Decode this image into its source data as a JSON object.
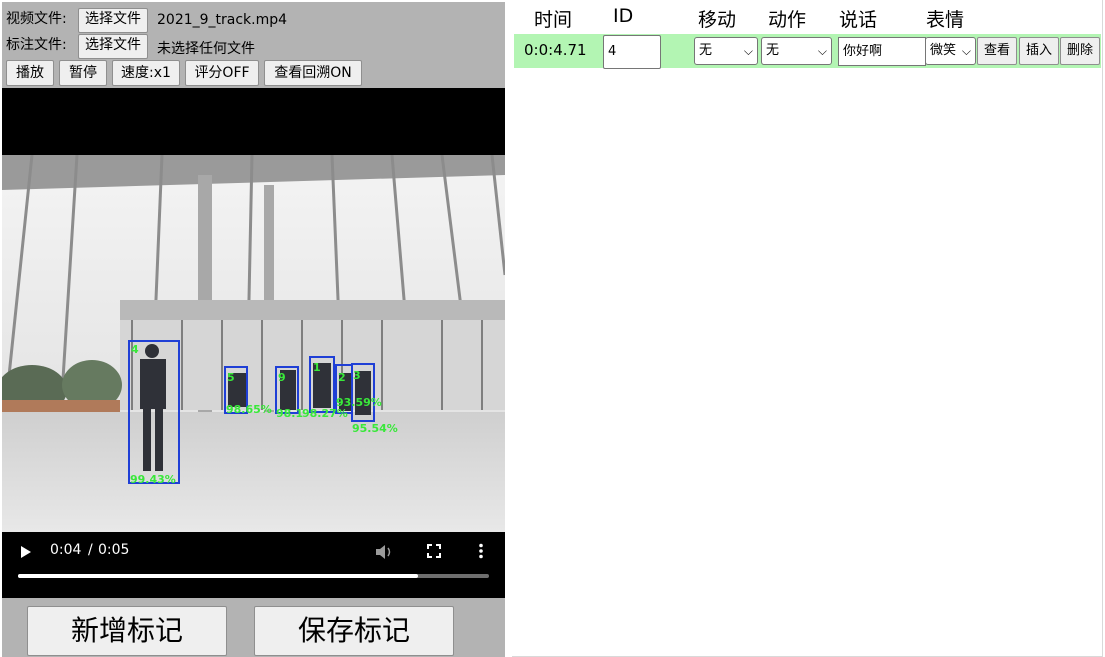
{
  "left": {
    "video_label": "视频文件:",
    "choose_file": "选择文件",
    "video_filename": "2021_9_track.mp4",
    "anno_label": "标注文件:",
    "anno_filename": "未选择任何文件",
    "controls": {
      "play": "播放",
      "pause": "暂停",
      "speed": "速度:x1",
      "score": "评分OFF",
      "replay": "查看回溯ON"
    },
    "player": {
      "time_current": "0:04",
      "time_sep": "/",
      "time_total": "0:05",
      "progress_fraction": 0.85
    },
    "detections": [
      {
        "id": "4",
        "score": "99.43%"
      },
      {
        "id": "5",
        "score": "98.65%"
      },
      {
        "id": "9",
        "score": "98.1"
      },
      {
        "id": "1",
        "score": "98.27%"
      },
      {
        "id": "2",
        "score": "93.59%"
      },
      {
        "id": "3",
        "score": "95.54%"
      }
    ],
    "add_mark": "新增标记",
    "save_mark": "保存标记"
  },
  "table": {
    "headers": {
      "time": "时间",
      "id": "ID",
      "move": "移动",
      "action": "动作",
      "speech": "说话",
      "expression": "表情"
    },
    "row": {
      "time": "0:0:4.71",
      "id": "4",
      "move": "无",
      "action": "无",
      "speech": "你好啊",
      "expression": "微笑",
      "view": "查看",
      "insert": "插入",
      "delete": "删除"
    }
  }
}
